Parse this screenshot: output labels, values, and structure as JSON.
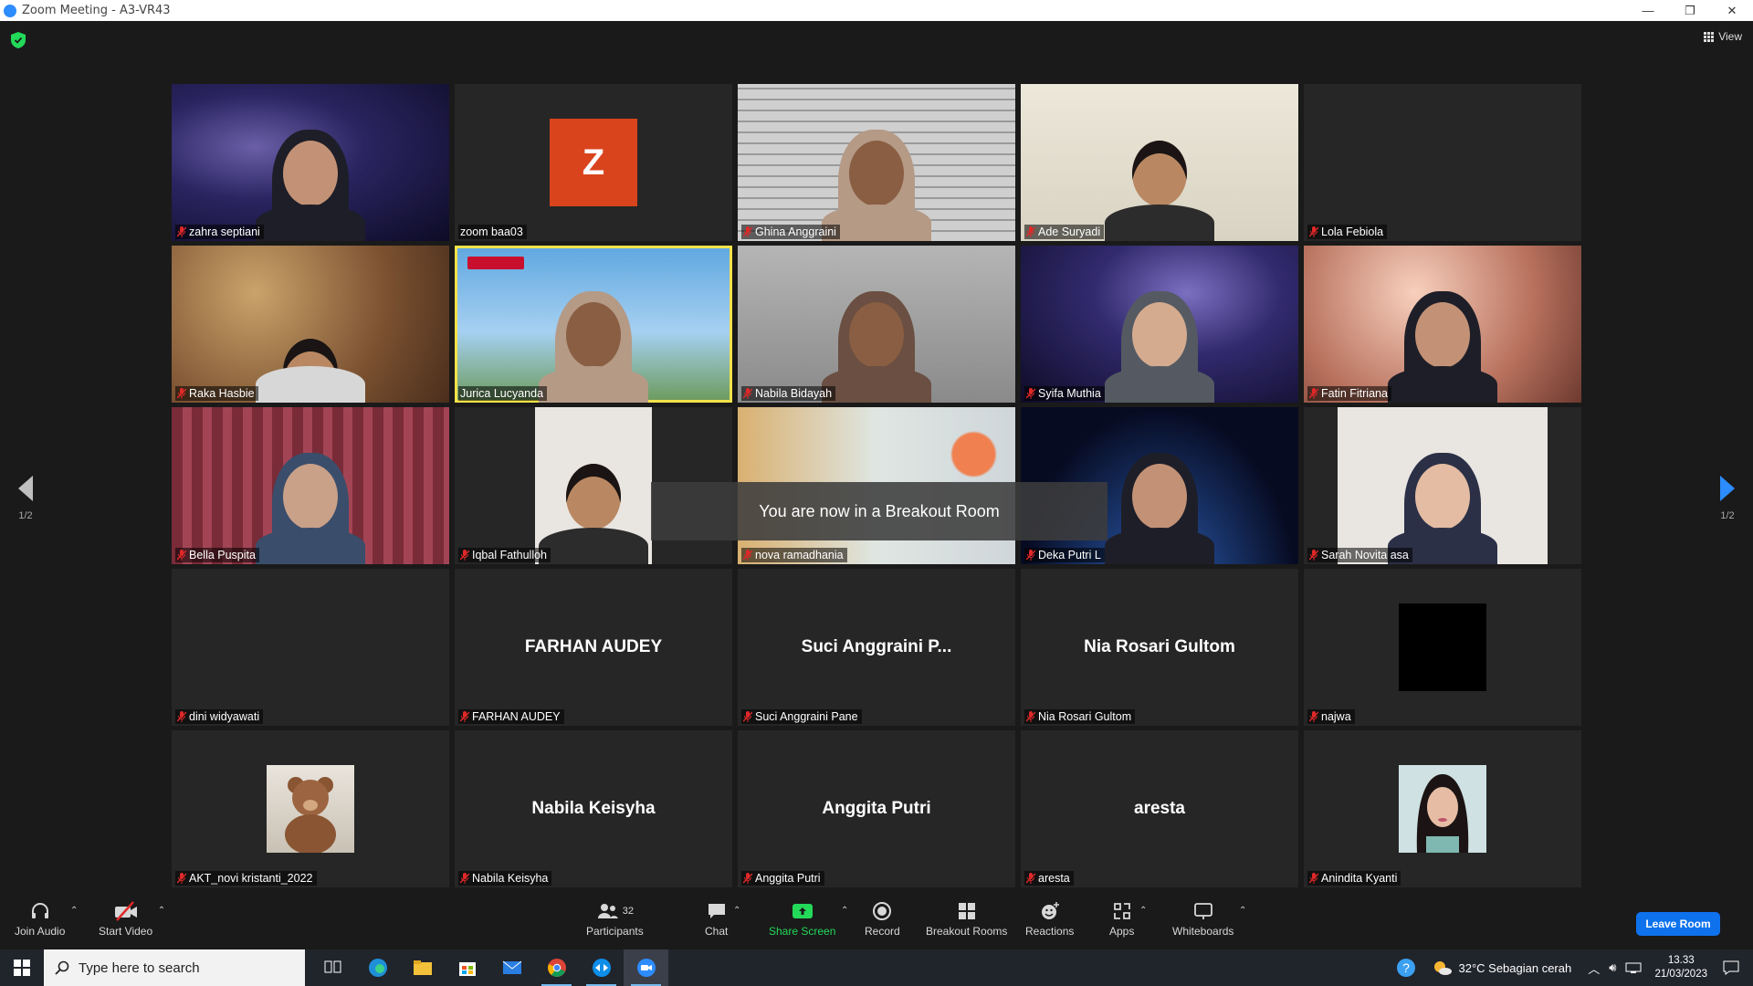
{
  "window": {
    "title": "Zoom Meeting - A3-VR43",
    "controls": [
      "—",
      "❐",
      "✕"
    ]
  },
  "header": {
    "view_label": "View"
  },
  "pager": {
    "left": "1/2",
    "right": "1/2"
  },
  "banner": "You are now in a Breakout Room",
  "tiles": [
    {
      "name": "zahra septiani",
      "bg": "galaxy",
      "person": "hijab-dark"
    },
    {
      "name": "zoom baa03",
      "avatar_letter": "Z"
    },
    {
      "name": "Ghina Anggraini",
      "bg": "bricks",
      "person": "hijab-beige"
    },
    {
      "name": "Ade Suryadi",
      "bg": "room",
      "person": "man"
    },
    {
      "name": "Lola Febiola"
    },
    {
      "name": "Raka Hasbie",
      "bg": "food",
      "person": "man-low"
    },
    {
      "name": "Jurica Lucyanda",
      "bg": "office",
      "person": "hijab-beige",
      "active": true
    },
    {
      "name": "Nabila Bidayah",
      "bg": "grey",
      "person": "hijab-brown"
    },
    {
      "name": "Syifa Muthia",
      "bg": "galaxy2",
      "person": "hijab-grey"
    },
    {
      "name": "Fatin Fitriana",
      "bg": "window",
      "person": "hijab-dark"
    },
    {
      "name": "Bella Puspita",
      "bg": "curtain",
      "person": "hijab-blue"
    },
    {
      "name": "Iqbal Fathulloh",
      "inset": "white-wall",
      "person": "man"
    },
    {
      "name": "nova ramadhania",
      "bg": "blur"
    },
    {
      "name": "Deka Putri L",
      "bg": "earth",
      "person": "hijab-dark"
    },
    {
      "name": "Sarah Novita asa",
      "inset": "white-wall",
      "person": "hijab-navy"
    },
    {
      "name": "dini widyawati"
    },
    {
      "name": "FARHAN AUDEY",
      "display_name": "FARHAN AUDEY"
    },
    {
      "name": "Suci Anggraini Pane",
      "display_name": "Suci Anggraini P..."
    },
    {
      "name": "Nia Rosari Gultom",
      "display_name": "Nia Rosari Gultom"
    },
    {
      "name": "najwa",
      "black_box": true
    },
    {
      "name": "AKT_novi kristanti_2022",
      "avatar_photo": "teddy"
    },
    {
      "name": "Nabila Keisyha",
      "display_name": "Nabila Keisyha"
    },
    {
      "name": "Anggita Putri",
      "display_name": "Anggita Putri"
    },
    {
      "name": "aresta",
      "display_name": "aresta"
    },
    {
      "name": "Anindita Kyanti",
      "avatar_photo": "girl"
    }
  ],
  "toolbar": {
    "join_audio": "Join Audio",
    "start_video": "Start Video",
    "participants": "Participants",
    "participants_count": "32",
    "chat": "Chat",
    "share_screen": "Share Screen",
    "record": "Record",
    "breakout_rooms": "Breakout Rooms",
    "reactions": "Reactions",
    "apps": "Apps",
    "whiteboards": "Whiteboards",
    "leave_room": "Leave Room"
  },
  "taskbar": {
    "search_placeholder": "Type here to search",
    "weather": "32°C  Sebagian cerah",
    "time": "13.33",
    "date": "21/03/2023"
  },
  "colors": {
    "accent": "#2d8cff",
    "active_speaker": "#f3e24a",
    "muted_mic": "#e02828",
    "share_green": "#23d959",
    "leave": "#0e72ed"
  }
}
